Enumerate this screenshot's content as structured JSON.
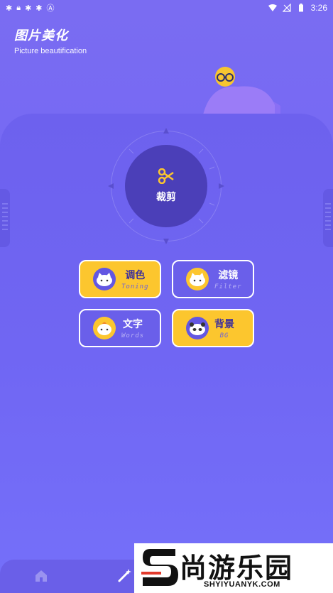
{
  "status_bar": {
    "left_icons": [
      "bug-icon",
      "lock-icon",
      "bug-icon",
      "bug-icon",
      "a-icon"
    ],
    "time": "3:26"
  },
  "header": {
    "title": "图片美化",
    "subtitle": "Picture beautification"
  },
  "dial": {
    "label": "裁剪",
    "icon": "scissors-icon"
  },
  "tools": [
    {
      "cn": "调色",
      "en": "Toning",
      "style": "yellow"
    },
    {
      "cn": "滤镜",
      "en": "Filter",
      "style": "purple"
    },
    {
      "cn": "文字",
      "en": "Words",
      "style": "purple"
    },
    {
      "cn": "背景",
      "en": "BG",
      "style": "yellow"
    }
  ],
  "watermark": {
    "main": "尚游乐园",
    "sub": "SHYIYUANYK.COM"
  },
  "colors": {
    "accent_yellow": "#fcc62e",
    "purple": "#6a5fea",
    "dark_purple": "#4b3fb8"
  }
}
